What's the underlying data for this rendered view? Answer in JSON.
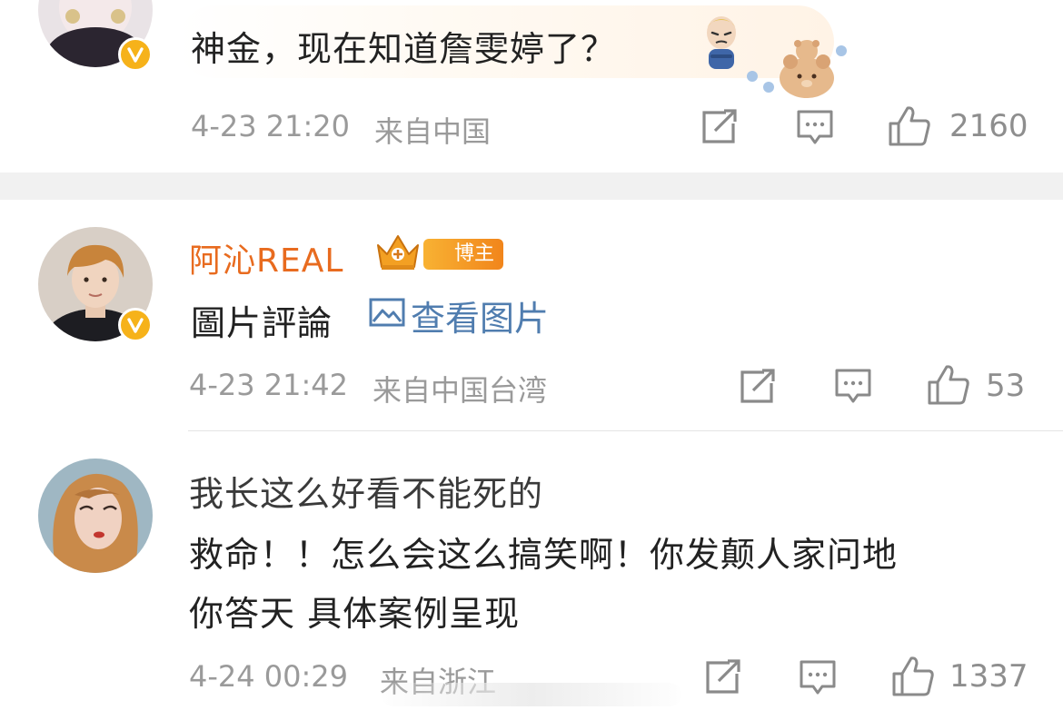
{
  "comments": [
    {
      "text": "神金，现在知道詹雯婷了？",
      "time": "4-23 21:20",
      "location": "来自中国",
      "likes": "2160"
    },
    {
      "username": "阿沁REAL",
      "badge": "博主",
      "text": "圖片評論",
      "view_image": "查看图片",
      "time": "4-23 21:42",
      "location": "来自中国台湾",
      "likes": "53"
    },
    {
      "line1": "我长这么好看不能死的",
      "line2": "救命！！怎么会这么搞笑啊！你发颠人家问地",
      "line3": "你答天 具体案例呈现",
      "time": "4-24 00:29",
      "location": "来自浙江",
      "likes": "1337"
    }
  ],
  "icons": {
    "share": "share-icon",
    "comment": "comment-icon",
    "like": "thumbs-up-icon",
    "verified": "verified-v-icon",
    "image": "image-icon",
    "crown": "crown-icon"
  },
  "colors": {
    "username": "#e86b1f",
    "link": "#507daf",
    "meta": "#9a9a9a",
    "verified_badge": "#f6b21a"
  }
}
